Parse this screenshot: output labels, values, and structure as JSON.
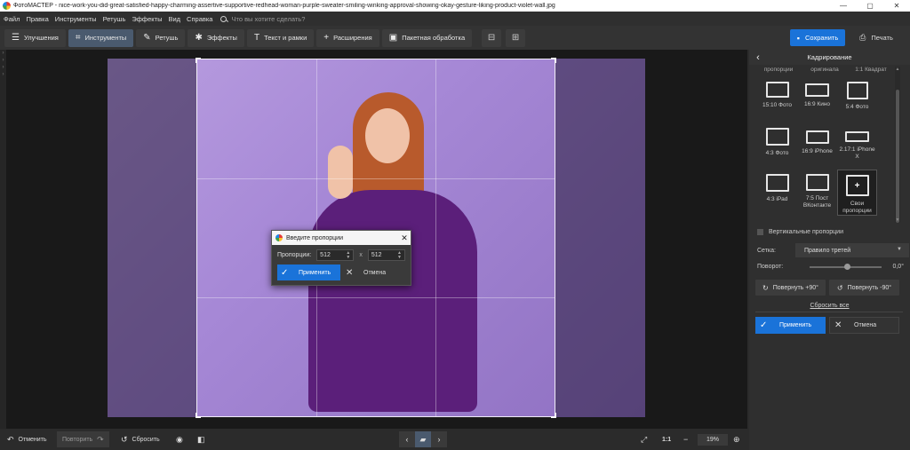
{
  "window": {
    "title": "ФотоМАСТЕР - nice-work-you-did-great-satisfied-happy-charming-assertive-supportive-redhead-woman-purple-sweater-smiling-winking-approval-showing-okay-gesture-liking-product-violet-wall.jpg",
    "minimize": "—",
    "maximize": "▢",
    "close": "✕"
  },
  "menu": {
    "items": [
      "Файл",
      "Правка",
      "Инструменты",
      "Ретушь",
      "Эффекты",
      "Вид",
      "Справка"
    ],
    "search_placeholder": "Что вы хотите сделать?"
  },
  "toolbar": {
    "tabs": [
      {
        "label": "Улучшения",
        "icon": "sliders-icon"
      },
      {
        "label": "Инструменты",
        "icon": "crop-icon"
      },
      {
        "label": "Ретушь",
        "icon": "brush-icon"
      },
      {
        "label": "Эффекты",
        "icon": "sparkle-icon"
      },
      {
        "label": "Текст и рамки",
        "icon": "text-icon"
      },
      {
        "label": "Расширения",
        "icon": "plus-icon"
      },
      {
        "label": "Пакетная обработка",
        "icon": "batch-icon"
      }
    ],
    "active_tab": "Инструменты",
    "save_label": "Сохранить",
    "print_label": "Печать"
  },
  "dialog": {
    "title": "Введите пропорции",
    "proportions_label": "Пропорции:",
    "width_value": "512",
    "separator": "x",
    "height_value": "512",
    "apply_label": "Применить",
    "cancel_label": "Отмена"
  },
  "panel": {
    "title": "Кадрирование",
    "top_labels": [
      "пропорции",
      "оригинала",
      "1:1 Квадрат"
    ],
    "presets": [
      {
        "label": "15:10 Фото",
        "icon": "landscape-frame-icon"
      },
      {
        "label": "16:9 Кино",
        "icon": "wide-frame-icon"
      },
      {
        "label": "5:4 Фото",
        "icon": "square-frame-icon"
      },
      {
        "label": "4:3 Фото",
        "icon": "landscape-frame-icon"
      },
      {
        "label": "16:9 iPhone",
        "icon": "wide-frame-icon"
      },
      {
        "label": "2.17:1 iPhone X",
        "icon": "ultrawide-frame-icon"
      },
      {
        "label": "4:3 iPad",
        "icon": "landscape-frame-icon"
      },
      {
        "label": "7:5 Пост ВКонтакте",
        "icon": "landscape-frame-icon"
      },
      {
        "label": "Свои пропорции",
        "icon": "custom-proportions-icon"
      }
    ],
    "selected_preset": "Свои пропорции",
    "vertical_label": "Вертикальные пропорции",
    "vertical_checked": false,
    "grid_label": "Сетка:",
    "grid_value": "Правило третей",
    "rotation_label": "Поворот:",
    "rotation_value": "0,0°",
    "rotate_plus_label": "Повернуть +90°",
    "rotate_minus_label": "Повернуть -90°",
    "reset_all_label": "Сбросить все",
    "apply_label": "Применить",
    "cancel_label": "Отмена"
  },
  "bottom": {
    "undo_label": "Отменить",
    "redo_label": "Повторить",
    "reset_label": "Сбросить",
    "one_to_one_label": "1:1",
    "zoom_value": "19%"
  },
  "colors": {
    "accent": "#1a73d9",
    "background": "#2b2b2b",
    "photo_bg": "#a688d6"
  }
}
